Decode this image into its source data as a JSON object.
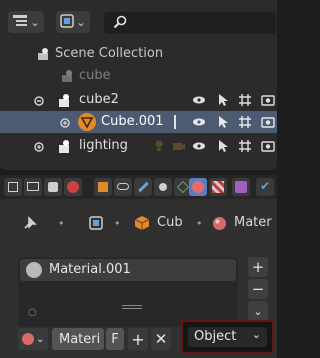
{
  "outliner": {
    "search": {
      "placeholder": ""
    },
    "rows": [
      {
        "label": "Scene Collection"
      },
      {
        "label": "cube"
      },
      {
        "label": "cube2"
      },
      {
        "label": "Cube.001"
      },
      {
        "label": "lighting"
      }
    ]
  },
  "properties": {
    "breadcrumb": {
      "item1": "Cub",
      "item2": "Mater"
    },
    "material_slot": {
      "label": "Material.001"
    },
    "material_field": {
      "label": "Materi",
      "fake_user": "F"
    },
    "link_select": {
      "value": "Object"
    }
  },
  "colors": {
    "selected_row": "#4c5a72",
    "active_tab": "#5680c2",
    "highlight_border": "#6b1212",
    "material_icon": "#e08a2a"
  }
}
